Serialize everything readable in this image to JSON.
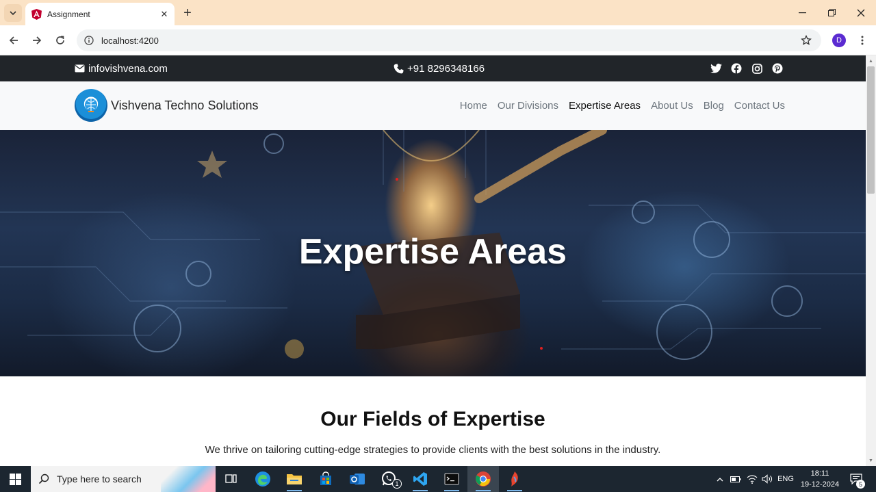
{
  "browser": {
    "tab_title": "Assignment",
    "url": "localhost:4200",
    "profile_initial": "D"
  },
  "topbar": {
    "email": "infovishvena.com",
    "phone": "+91 8296348166",
    "socials": [
      "twitter-icon",
      "facebook-icon",
      "instagram-icon",
      "pinterest-icon"
    ]
  },
  "navbar": {
    "brand": "Vishvena Techno Solutions",
    "links": [
      "Home",
      "Our Divisions",
      "Expertise Areas",
      "About Us",
      "Blog",
      "Contact Us"
    ],
    "active": "Expertise Areas"
  },
  "hero": {
    "title": "Expertise Areas"
  },
  "section": {
    "title": "Our Fields of Expertise",
    "text": "We thrive on tailoring cutting-edge strategies to provide clients with the best solutions in the industry."
  },
  "taskbar": {
    "search_placeholder": "Type here to search",
    "whatsapp_badge": "1",
    "language": "ENG",
    "time": "18:11",
    "date": "19-12-2024",
    "notification_count": "5"
  },
  "colors": {
    "tabstrip": "#fbe3c6",
    "topbar": "#212529",
    "navbar": "#f8f9fa",
    "profile": "#5b2bd1"
  }
}
